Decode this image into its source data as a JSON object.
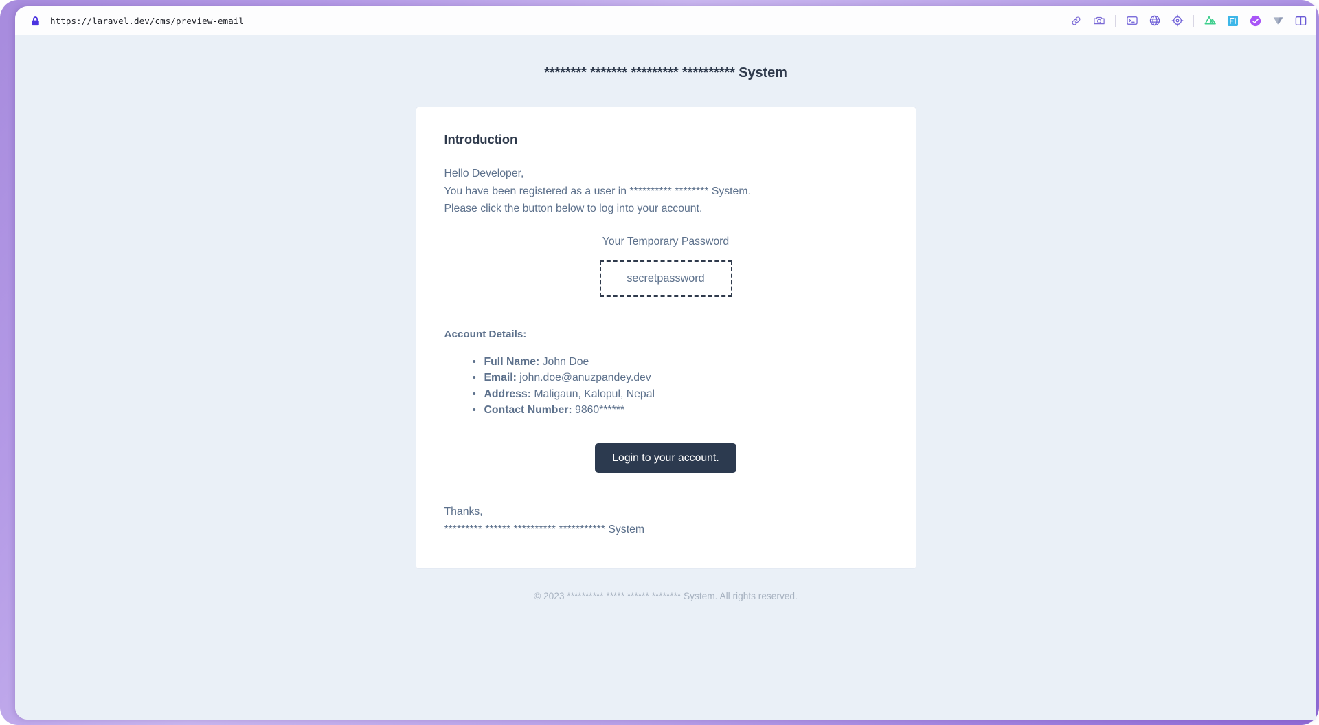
{
  "browser": {
    "url": "https://laravel.dev/cms/preview-email",
    "lock_icon": "lock-icon",
    "toolbar_icons": [
      {
        "name": "link-icon",
        "label": "Copy link"
      },
      {
        "name": "camera-icon",
        "label": "Screenshot"
      },
      {
        "name": "terminal-icon",
        "label": "Console"
      },
      {
        "name": "globe-icon",
        "label": "Network"
      },
      {
        "name": "target-icon",
        "label": "Inspect element"
      },
      {
        "name": "nuxt-extension-icon",
        "label": "Nuxt DevTools",
        "color": "#3fcf8e"
      },
      {
        "name": "fi-extension-icon",
        "label": "FI",
        "color": "#3db6e8"
      },
      {
        "name": "check-extension-icon",
        "label": "Checker",
        "color": "#a855f7"
      },
      {
        "name": "vuetify-extension-icon",
        "label": "Vuetify",
        "color": "#9aa3b8"
      },
      {
        "name": "split-panel-icon",
        "label": "Split panel",
        "color": "#6b5bd6"
      }
    ]
  },
  "email": {
    "title": "******** ******* ********* ********** System",
    "intro_heading": "Introduction",
    "greeting": "Hello Developer,",
    "registered_line": "You have been registered as a user in ********** ******** System.",
    "instruction_line": "Please click the button below to log into your account.",
    "temp_password_label": "Your Temporary Password",
    "temp_password_value": "secretpassword",
    "account_details_heading": "Account Details:",
    "account_details": [
      {
        "key": "Full Name:",
        "value": "John Doe"
      },
      {
        "key": "Email:",
        "value": "john.doe@anuzpandey.dev"
      },
      {
        "key": "Address:",
        "value": "Maligaun, Kalopul, Nepal"
      },
      {
        "key": "Contact Number:",
        "value": "9860******"
      }
    ],
    "login_button_label": "Login to your account.",
    "thanks_line": "Thanks,",
    "signature_line": "********* ****** ********** *********** System",
    "footer": "© 2023 ********** ***** ****** ******** System. All rights reserved."
  },
  "colors": {
    "page_background": "#eaf0f7",
    "card_background": "#ffffff",
    "heading": "#2f3a4c",
    "body_text": "#5d718c",
    "button_background": "#2c3a4f",
    "button_text": "#ffffff",
    "footer_text": "#a7b2c0",
    "frame_purple": "#a78bdd"
  }
}
